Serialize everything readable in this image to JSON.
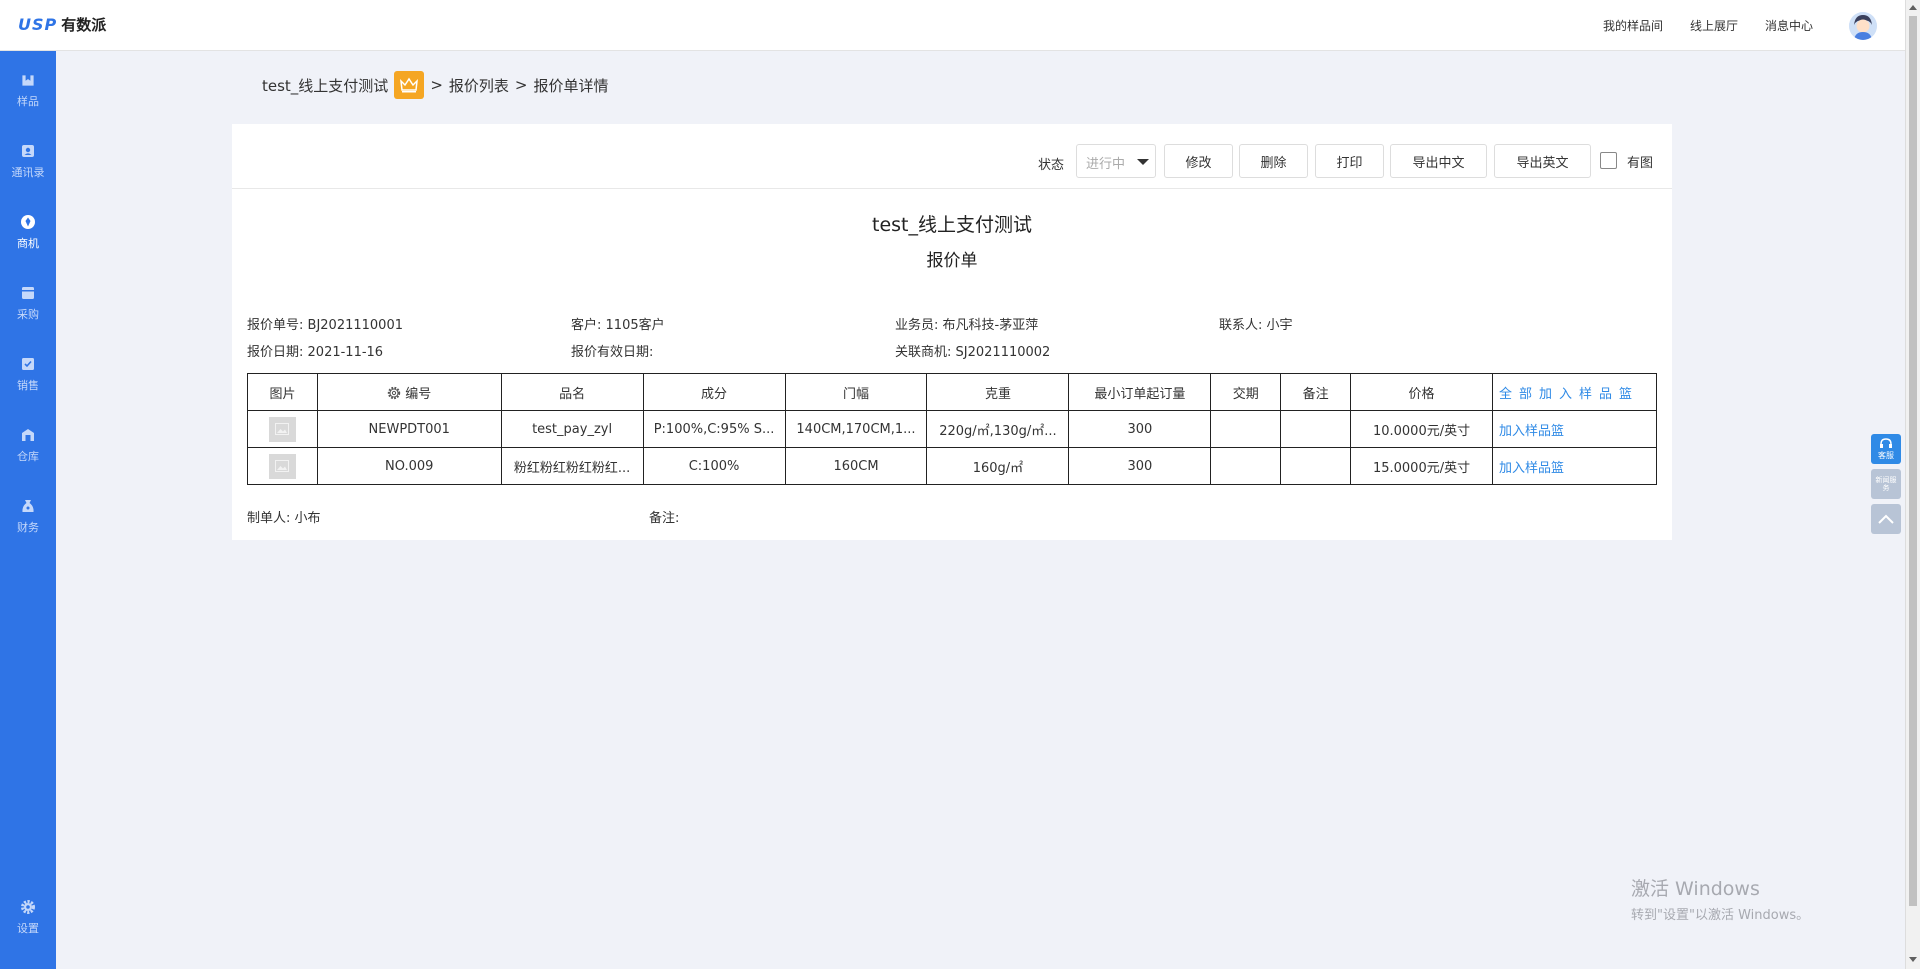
{
  "header": {
    "logo_mark": "USP",
    "logo_text": "有数派",
    "nav": [
      "我的样品间",
      "线上展厅",
      "消息中心"
    ]
  },
  "sidebar": {
    "items": [
      {
        "label": "样品",
        "icon": "sample-icon"
      },
      {
        "label": "通讯录",
        "icon": "contacts-icon"
      },
      {
        "label": "商机",
        "icon": "opportunity-icon",
        "active": true
      },
      {
        "label": "采购",
        "icon": "purchase-icon"
      },
      {
        "label": "销售",
        "icon": "sales-icon"
      },
      {
        "label": "仓库",
        "icon": "warehouse-icon"
      },
      {
        "label": "财务",
        "icon": "finance-icon"
      }
    ],
    "settings_label": "设置"
  },
  "breadcrumb": {
    "company": "test_线上支付测试",
    "sep1": ">",
    "list": "报价列表",
    "sep2": ">",
    "current": "报价单详情"
  },
  "toolbar": {
    "status_label": "状态",
    "status_value": "进行中",
    "edit": "修改",
    "delete": "删除",
    "print": "打印",
    "export_cn": "导出中文",
    "export_en": "导出英文",
    "with_image_label": "有图",
    "with_image_checked": false
  },
  "document": {
    "title": "test_线上支付测试",
    "subtitle": "报价单",
    "quote_no_label": "报价单号:",
    "quote_no": "BJ2021110001",
    "customer_label": "客户:",
    "customer": "1105客户",
    "salesperson_label": "业务员:",
    "salesperson": "布凡科技-茅亚萍",
    "contact_label": "联系人:",
    "contact": "小宇",
    "quote_date_label": "报价日期:",
    "quote_date": "2021-11-16",
    "valid_date_label": "报价有效日期:",
    "valid_date": "",
    "related_label": "关联商机:",
    "related": "SJ2021110002",
    "maker_label": "制单人:",
    "maker": "小布",
    "remark_label": "备注:",
    "remark": ""
  },
  "table": {
    "headers": {
      "image": "图片",
      "code": "编号",
      "name": "品名",
      "composition": "成分",
      "width": "门幅",
      "weight": "克重",
      "moq": "最小订单起订量",
      "lead_time": "交期",
      "note": "备注",
      "price": "价格",
      "add_all": "全部加入样品篮"
    },
    "rows": [
      {
        "code": "NEWPDT001",
        "name": "test_pay_zyl",
        "composition": "P:100%,C:95% S...",
        "width": "140CM,170CM,1...",
        "weight": "220g/㎡,130g/㎡...",
        "moq": "300",
        "lead_time": "",
        "note": "",
        "price": "10.0000元/英寸",
        "action": "加入样品篮"
      },
      {
        "code": "NO.009",
        "name": "粉红粉红粉红粉红...",
        "composition": "C:100%",
        "width": "160CM",
        "weight": "160g/㎡",
        "moq": "300",
        "lead_time": "",
        "note": "",
        "price": "15.0000元/英寸",
        "action": "加入样品篮"
      }
    ]
  },
  "float": {
    "service": "客服",
    "news": "新闻服务"
  },
  "watermark": {
    "line1": "激活 Windows",
    "line2": "转到\"设置\"以激活 Windows。"
  },
  "colors": {
    "primary": "#2f74e6",
    "link": "#2f8ae6",
    "crown": "#f5a623",
    "page_bg": "#f0f2f8"
  }
}
